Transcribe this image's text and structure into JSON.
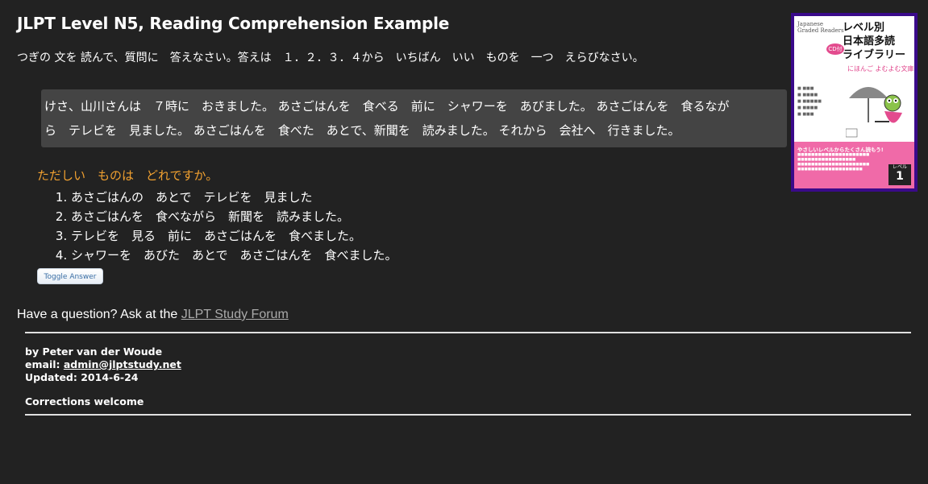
{
  "header": {
    "title": "JLPT Level N5, Reading Comprehension Example",
    "instructions": "つぎの 文を 読んで、質問に　答えなさい。答えは　１．２．３．４から　いちばん　いい　ものを　一つ　えらびなさい。"
  },
  "passage": {
    "line1": "けさ、山川さんは　７時に　おきました。 あさごはんを　食べる　前に　シャワーを　あびました。 あさごはんを　食るなが",
    "line2": "ら　テレビを　見ました。 あさごはんを　食べた　あとで、新聞を　読みました。 それから　会社へ　行きました。"
  },
  "question": {
    "text": "ただしい　ものは　どれですか。",
    "options": [
      "あさごはんの　あとで　テレビを　見ました",
      "あさごはんを　食べながら　新聞を　読みました。",
      "テレビを　見る　前に　あさごはんを　食べました。",
      "シャワーを　あびた　あとで　あさごはんを　食べました。"
    ],
    "toggle_label": "Toggle Answer"
  },
  "ask": {
    "prefix": "Have a question? Ask at the ",
    "link": "JLPT Study Forum"
  },
  "footer": {
    "author": "by Peter van der Woude",
    "email_label": "email: ",
    "email": "admin@jlptstudy.net",
    "updated": "Updated: 2014-6-24",
    "corrections": "Corrections welcome"
  },
  "book": {
    "series_en_1": "Japanese",
    "series_en_2": "Graded Readers",
    "title_1": "レベル別",
    "title_2": "日本語多読",
    "title_3": "ライブラリー",
    "subtitle": "にほんご よむよむ文庫",
    "cd": "CD付",
    "band_head": "やさしいレベルからたくさん読もう!",
    "level_label": "レベル",
    "level_number": "1",
    "colors": {
      "border": "#3a0a8a",
      "band": "#f06aa8",
      "accent": "#e0428a"
    }
  },
  "colors": {
    "background": "#222222",
    "passage_bg": "#444444",
    "question": "#f0a030",
    "link": "#aaaaaa"
  }
}
